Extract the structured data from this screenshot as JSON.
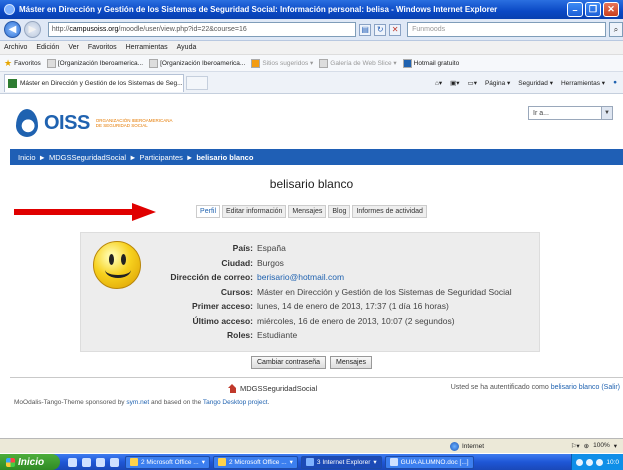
{
  "window": {
    "title": "Máster en Dirección y Gestión de los Sistemas de Seguridad Social: Información personal: belisa - Windows Internet Explorer"
  },
  "address": {
    "url_prefix": "http://",
    "url_domain": "campusoiss.org",
    "url_rest": "/moodle/user/view.php?id=22&course=16",
    "search_placeholder": "Funmoods"
  },
  "menu": {
    "items": [
      "Archivo",
      "Edición",
      "Ver",
      "Favoritos",
      "Herramientas",
      "Ayuda"
    ]
  },
  "favorites": {
    "label": "Favoritos",
    "items": [
      "[Organización Iberoamerica...",
      "[Organización Iberoamerica...",
      "Sitios sugeridos ▾",
      "Galería de Web Slice ▾",
      "Hotmail gratuito"
    ]
  },
  "browser_tab": {
    "label": "Máster en Dirección y Gestión de los Sistemas de Seg...",
    "tools": [
      "Página ▾",
      "Seguridad ▾",
      "Herramientas ▾"
    ]
  },
  "site": {
    "logo_word": "OISS",
    "logo_sub_1": "ORGANIZACIÓN IBEROAMERICANA",
    "logo_sub_2": "DE SEGURIDAD SOCIAL",
    "jump_placeholder": "Ir a..."
  },
  "breadcrumb": {
    "home": "Inicio",
    "sep": "►",
    "course": "MDGSSeguridadSocial",
    "participants": "Participantes",
    "current": "belisario blanco"
  },
  "profile": {
    "name": "belisario blanco",
    "tabs": [
      "Perfil",
      "Editar información",
      "Mensajes",
      "Blog",
      "Informes de actividad"
    ],
    "active_tab": "Perfil",
    "fields": [
      {
        "label": "País:",
        "value": "España",
        "link": false
      },
      {
        "label": "Ciudad:",
        "value": "Burgos",
        "link": false
      },
      {
        "label": "Dirección de correo:",
        "value": "berisario@hotmail.com",
        "link": true
      },
      {
        "label": "Cursos:",
        "value": "Máster en Dirección y Gestión de los Sistemas de Seguridad Social",
        "link": false
      },
      {
        "label": "Primer acceso:",
        "value": "lunes, 14 de enero de 2013, 17:37  (1 día 16 horas)",
        "link": false
      },
      {
        "label": "Último acceso:",
        "value": "miércoles, 16 de enero de 2013, 10:07  (2 segundos)",
        "link": false
      },
      {
        "label": "Roles:",
        "value": "Estudiante",
        "link": false
      }
    ],
    "buttons": {
      "change_password": "Cambiar contraseña",
      "messages": "Mensajes"
    }
  },
  "footer": {
    "home_link": "MDGSSeguridadSocial",
    "login_prefix": "Usted se ha autentificado como ",
    "login_user": "belisario blanco",
    "login_logout": "(Salir)",
    "credit_prefix": "MoOdalis-Tango-Theme sponsored by ",
    "credit_sponsor": "sym.net",
    "credit_mid": " and based on the ",
    "credit_project": "Tango Desktop project",
    "credit_end": "."
  },
  "status_bar": {
    "zone": "Internet",
    "zoom": "100%"
  },
  "taskbar": {
    "start": "Inicio",
    "buttons": [
      "2 Microsoft Office ...",
      "2 Microsoft Office ...",
      "3 Internet Explorer",
      "GUIA ALUMNO.doc [...]"
    ],
    "active_index": 2,
    "clock": "10:0"
  },
  "colors": {
    "nav_blue": "#1f5fb5",
    "link_blue": "#1f62b0",
    "arrow_red": "#e00000"
  }
}
